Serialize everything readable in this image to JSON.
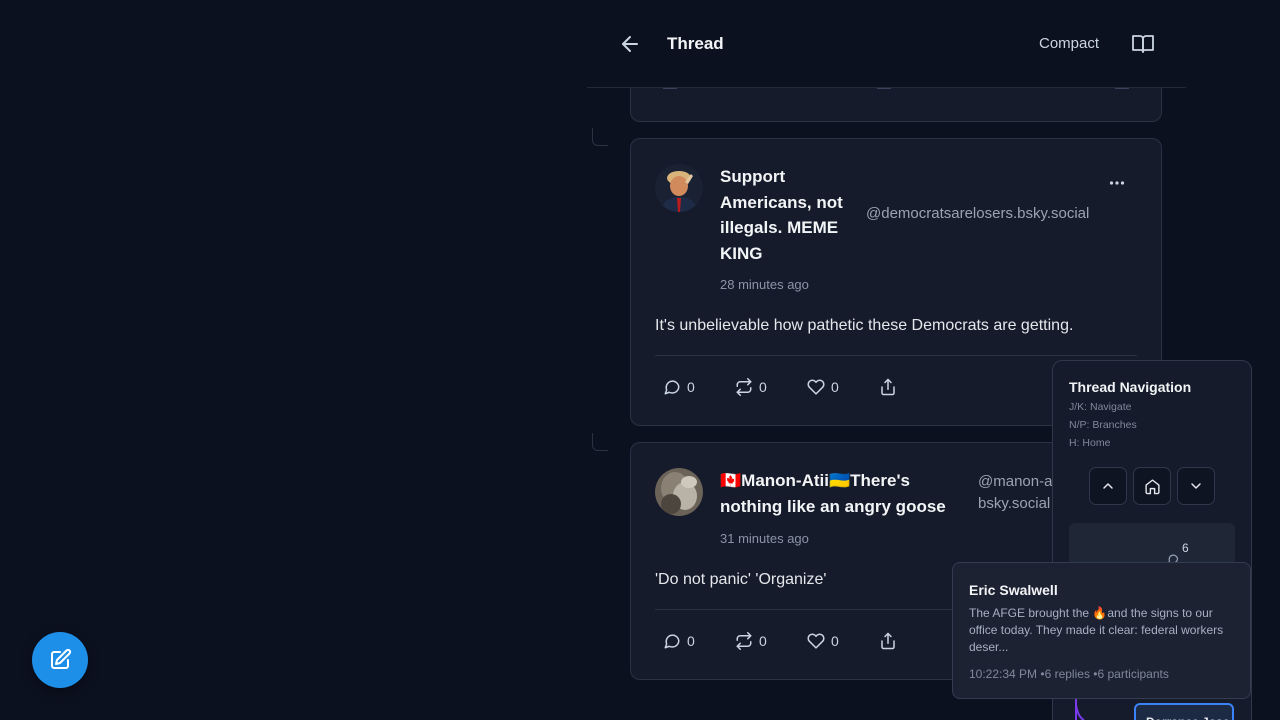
{
  "header": {
    "title": "Thread",
    "compact_label": "Compact"
  },
  "posts": [
    {
      "author": "Support Americans, not illegals. MEME KING",
      "handle": "@democratsarelosers.bsky.social",
      "time": "28 minutes ago",
      "text": "It's unbelievable how pathetic these Democrats are getting.",
      "replies": "0",
      "reposts": "0",
      "likes": "0"
    },
    {
      "author": "🇨🇦Manon-Atii🇺🇦There's nothing like an angry goose",
      "handle": "@manon-atii.bsky.social",
      "time": "31 minutes ago",
      "text": "'Do not panic'  'Organize'",
      "replies": "0",
      "reposts": "0",
      "likes": "0"
    }
  ],
  "nav_panel": {
    "title": "Thread Navigation",
    "hint_navigate": "J/K: Navigate",
    "hint_branches": "N/P: Branches",
    "hint_home": "H: Home",
    "minimap_count": "6"
  },
  "tooltip": {
    "name": "Eric Swalwell",
    "text": "The AFGE brought the 🔥and the signs to our office today. They made it clear: federal workers deser...",
    "meta": "10:22:34 PM •6 replies •6 participants"
  },
  "bottom_chip": "Dorrance Jose",
  "colors": {
    "background": "#0c1120",
    "card": "#151b2b",
    "accent": "#1d8fe8",
    "highlight": "#3b82f6"
  }
}
